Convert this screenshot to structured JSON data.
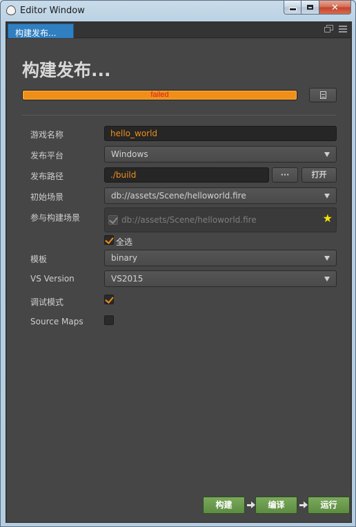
{
  "window": {
    "title": "Editor Window",
    "close_glyph": "✕"
  },
  "tab": {
    "label": "构建发布..."
  },
  "page": {
    "title": "构建发布..."
  },
  "progress": {
    "status": "failed",
    "value": 1.0,
    "color": "#f08f18"
  },
  "form": {
    "game_name_label": "游戏名称",
    "game_name_value": "hello_world",
    "platform_label": "发布平台",
    "platform_value": "Windows",
    "build_path_label": "发布路径",
    "build_path_value": "./build",
    "browse_label": "···",
    "open_label": "打开",
    "start_scene_label": "初始场景",
    "start_scene_value": "db://assets/Scene/helloworld.fire",
    "scenes_label": "参与构建场景",
    "scenes": [
      {
        "path": "db://assets/Scene/helloworld.fire",
        "checked": true,
        "is_start": true
      }
    ],
    "select_all_label": "全选",
    "select_all_checked": true,
    "template_label": "模板",
    "template_value": "binary",
    "vs_version_label": "VS Version",
    "vs_version_value": "VS2015",
    "debug_label": "调试模式",
    "debug_checked": true,
    "source_maps_label": "Source Maps",
    "source_maps_checked": false
  },
  "actions": {
    "build_label": "构建",
    "compile_label": "编译",
    "run_label": "运行",
    "accent_color": "#6a9a4e"
  },
  "icons": [
    "app-icon",
    "popout-icon",
    "menu-icon",
    "open-log-icon",
    "star-icon",
    "arrow-right-icon",
    "chevron-down-icon"
  ]
}
